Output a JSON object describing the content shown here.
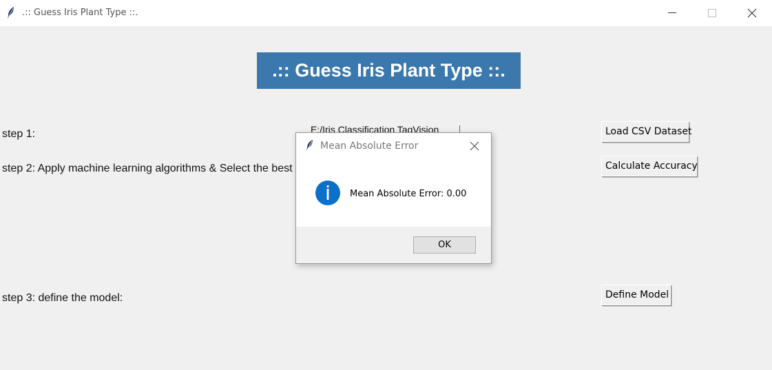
{
  "window": {
    "title": ".:: Guess Iris Plant Type ::."
  },
  "header": {
    "banner_text": ".:: Guess Iris Plant Type ::.",
    "banner_color": "#3b78ad"
  },
  "steps": {
    "step1_label": "step 1:",
    "step1_path": "E:/Iris Classification TagVision",
    "step2_label": "step 2: Apply machine learning algorithms & Select the best",
    "step3_label": "step 3: define the model:"
  },
  "buttons": {
    "load_csv": "Load CSV Dataset",
    "calc_accuracy": "Calculate Accuracy",
    "define_model": "Define Model"
  },
  "dialog": {
    "title": "Mean Absolute Error",
    "message": "Mean Absolute Error: 0.00",
    "ok_label": "OK",
    "info_icon": "info-icon",
    "info_color": "#0a70c9"
  }
}
